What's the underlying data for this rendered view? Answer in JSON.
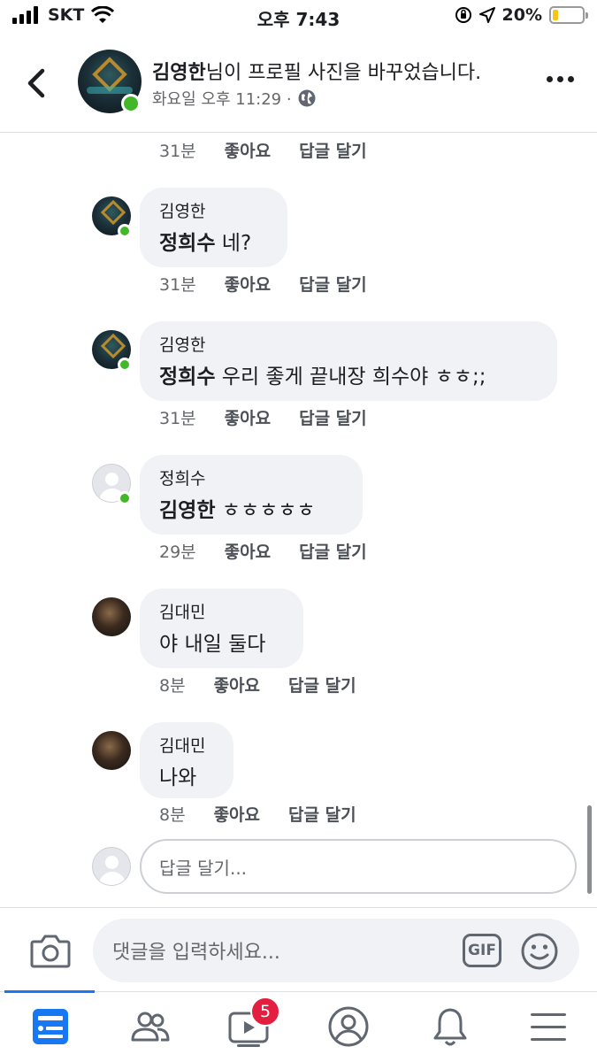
{
  "status_bar": {
    "carrier": "SKT",
    "time": "오후 7:43",
    "battery": "20%",
    "battery_level": 0.2
  },
  "header": {
    "title_name": "김영한",
    "title_rest": "님이 프로필 사진을 바꾸었습니다.",
    "subtitle": "화요일 오후 11:29 ·",
    "privacy_icon": "globe-icon"
  },
  "actions": {
    "like": "좋아요",
    "reply": "답글 달기"
  },
  "top_row": {
    "time": "31분"
  },
  "comments": [
    {
      "author": "김영한",
      "mention": "정희수",
      "text": " 네?",
      "time": "31분",
      "online": true,
      "avatar": "teal"
    },
    {
      "author": "김영한",
      "mention": "정희수",
      "text": " 우리 좋게 끝내장 희수야 ㅎㅎ;;",
      "time": "31분",
      "online": true,
      "avatar": "teal"
    },
    {
      "author": "정희수",
      "mention": "김영한",
      "text": " ㅎㅎㅎㅎㅎ",
      "time": "29분",
      "online": true,
      "avatar": "default"
    },
    {
      "author": "김대민",
      "mention": "",
      "text": "야 내일 둘다",
      "time": "8분",
      "online": false,
      "avatar": "dark"
    },
    {
      "author": "김대민",
      "mention": "",
      "text": "나와",
      "time": "8분",
      "online": false,
      "avatar": "dark"
    }
  ],
  "reply_box": {
    "placeholder": "답글 달기..."
  },
  "composer": {
    "placeholder": "댓글을 입력하세요...",
    "gif_label": "GIF"
  },
  "tabbar": {
    "video_badge": "5"
  }
}
